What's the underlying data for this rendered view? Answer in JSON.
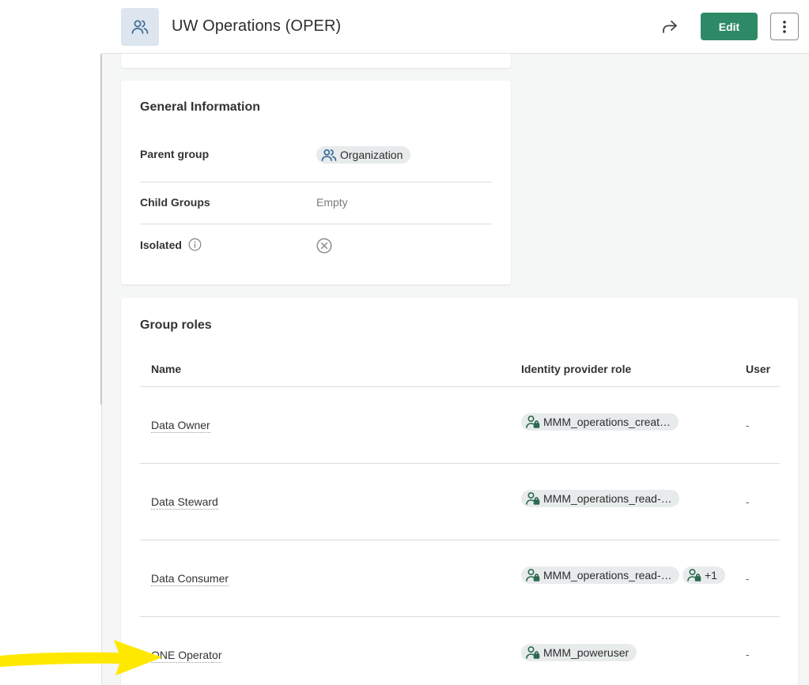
{
  "header": {
    "title": "UW Operations (OPER)",
    "edit_label": "Edit"
  },
  "general": {
    "title": "General Information",
    "parent_group_label": "Parent group",
    "parent_group_value": "Organization",
    "child_groups_label": "Child Groups",
    "child_groups_value": "Empty",
    "isolated_label": "Isolated"
  },
  "roles": {
    "title": "Group roles",
    "columns": {
      "name": "Name",
      "idp_role": "Identity provider role",
      "user": "User"
    },
    "rows": [
      {
        "name": "Data Owner",
        "idp_role": "MMM_operations_creat…",
        "extra": "",
        "user": "-"
      },
      {
        "name": "Data Steward",
        "idp_role": "MMM_operations_read-…",
        "extra": "",
        "user": "-"
      },
      {
        "name": "Data Consumer",
        "idp_role": "MMM_operations_read-…",
        "extra": "+1",
        "user": "-"
      },
      {
        "name": "ONE Operator",
        "idp_role": "MMM_poweruser",
        "extra": "",
        "user": "-"
      }
    ]
  },
  "colors": {
    "accent": "#2e8a66",
    "annotation_arrow": "#ffe800"
  }
}
